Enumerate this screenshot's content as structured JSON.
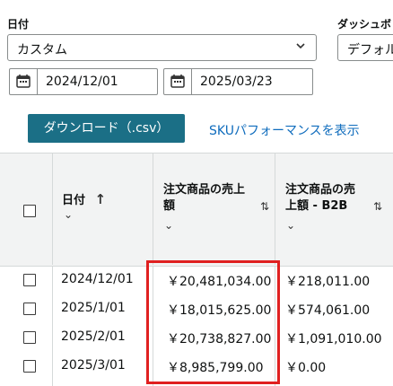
{
  "filters": {
    "date_label": "日付",
    "dashboard_label": "ダッシュボ",
    "date_range_select": "カスタム",
    "dashboard_select": "デフォルト",
    "start_date": "2024/12/01",
    "end_date": "2025/03/23"
  },
  "actions": {
    "download_label": "ダウンロード（.csv）",
    "sku_link_label": "SKUパフォーマンスを表示"
  },
  "table": {
    "columns": [
      {
        "line1": "日付",
        "sort": "↑",
        "chev": "⌄"
      },
      {
        "line1": "注文商品の売上",
        "line2": "額",
        "sort": "⇅",
        "chev": "⌄"
      },
      {
        "line1": "注文商品の売",
        "line2": "上額 - B2B",
        "sort": "⇅",
        "chev": "⌄"
      }
    ],
    "rows": [
      {
        "date": "2024/12/01",
        "sales": "￥20,481,034.00",
        "b2b": "￥218,011.00"
      },
      {
        "date": "2025/1/01",
        "sales": "￥18,015,625.00",
        "b2b": "￥574,061.00"
      },
      {
        "date": "2025/2/01",
        "sales": "￥20,738,827.00",
        "b2b": "￥1,091,010.00"
      },
      {
        "date": "2025/3/01",
        "sales": "￥8,985,799.00",
        "b2b": "￥0.00"
      }
    ]
  },
  "colors": {
    "button": "#1b6f86",
    "link": "#0f6cbd",
    "highlight": "#e02020"
  }
}
